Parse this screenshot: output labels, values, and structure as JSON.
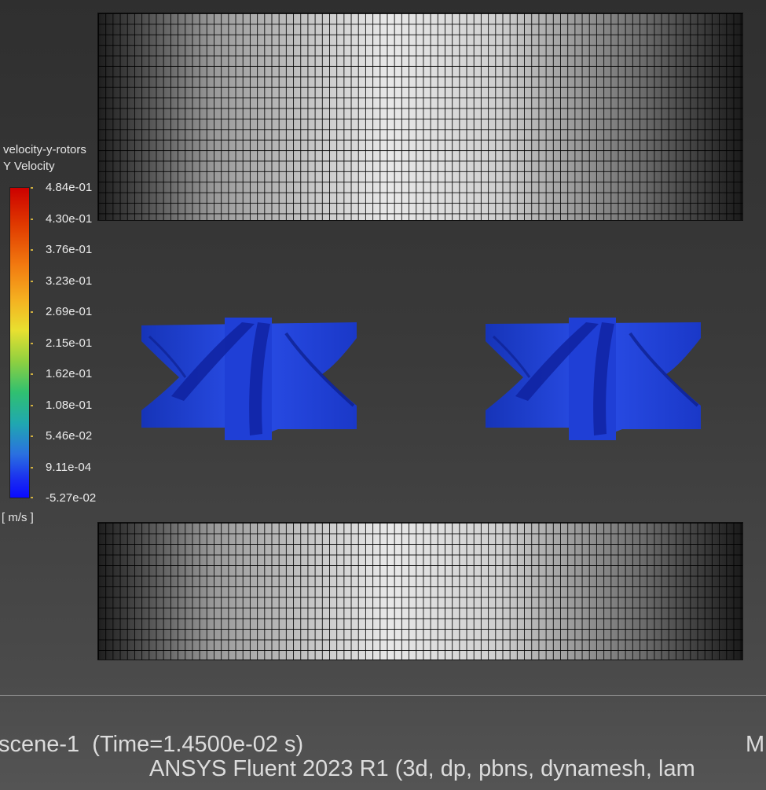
{
  "legend": {
    "title_line1": "velocity-y-rotors",
    "title_line2": "Y Velocity",
    "ticks": [
      "4.84e-01",
      "4.30e-01",
      "3.76e-01",
      "3.23e-01",
      "2.69e-01",
      "2.15e-01",
      "1.62e-01",
      "1.08e-01",
      "5.46e-02",
      "9.11e-04",
      "-5.27e-02"
    ],
    "units": "[ m/s ]",
    "max_color": "#cc0000",
    "min_color": "#0a0aff"
  },
  "footer": {
    "scene": "scene-1  (Time=1.4500e-02 s)",
    "right_char": "M",
    "solver": "ANSYS Fluent 2023 R1 (3d, dp, pbns, dynamesh, lam"
  },
  "colors": {
    "rotor_blue": "#1f3fd6",
    "rotor_dark": "#0f22a0",
    "background_top": "#2f2f2f",
    "background_bottom": "#545454"
  },
  "objects": {
    "top_mesh": "mesh-wall",
    "bottom_mesh": "mesh-wall",
    "left_rotor": "rotor",
    "right_rotor": "rotor"
  }
}
